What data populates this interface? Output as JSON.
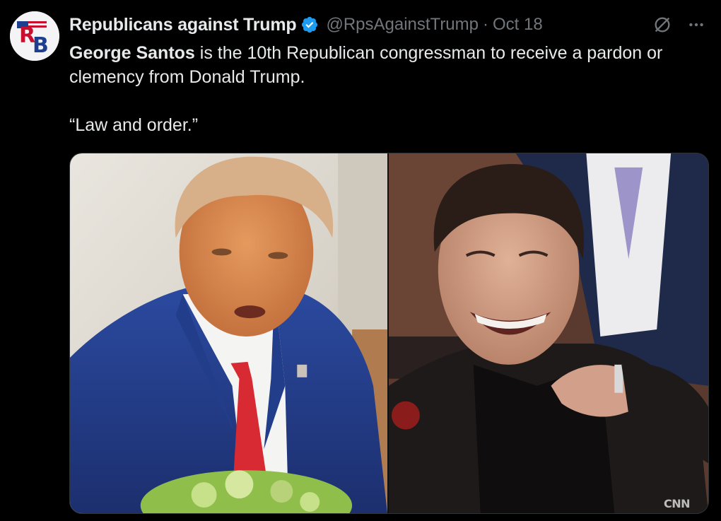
{
  "tweet": {
    "avatar_icon": "rb-logo-icon",
    "display_name": "Republicans against Trump",
    "verified_icon": "verified-badge-icon",
    "handle": "@RpsAgainstTrump",
    "separator": "·",
    "date": "Oct 18",
    "grok_icon": "grok-icon",
    "more_icon": "more-options-icon",
    "text_bold": "George Santos",
    "text_rest": " is the 10th Republican congressman to receive a pardon or clemency from Donald Trump.",
    "quote": "“Law and order.”"
  },
  "media": {
    "left_photo": "trump-photo",
    "right_photo": "santos-photo",
    "watermark": "CNN"
  },
  "colors": {
    "background": "#000000",
    "text": "#e7e9ea",
    "secondary": "#71767b",
    "verified_blue": "#1d9bf0",
    "border": "#2f3336"
  }
}
